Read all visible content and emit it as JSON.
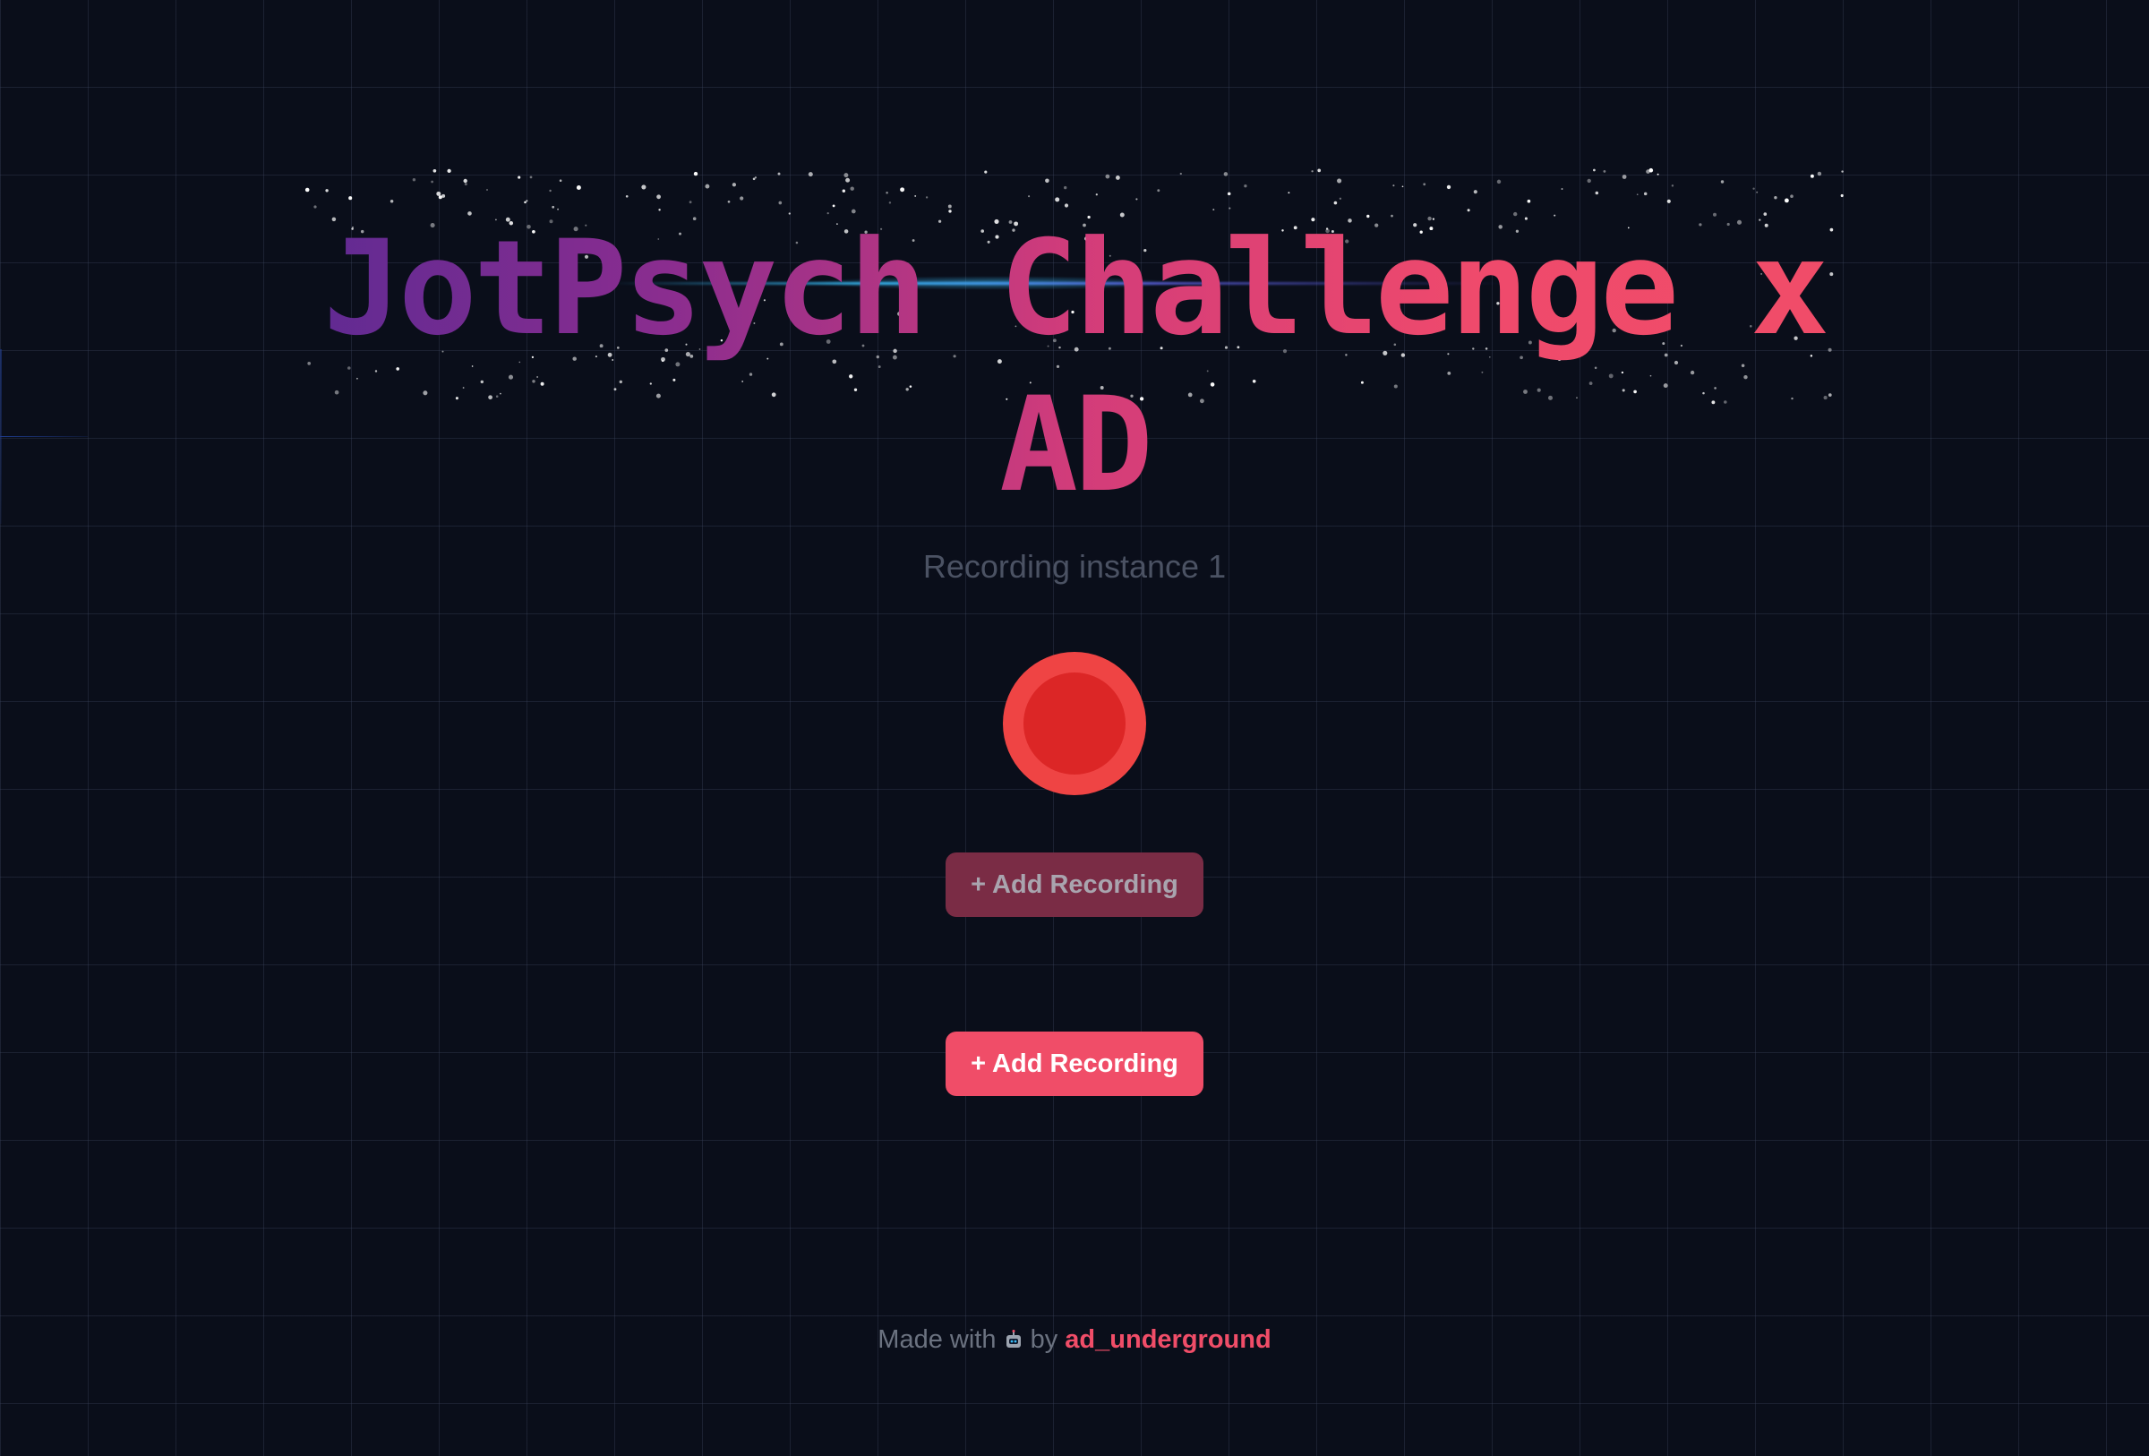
{
  "page": {
    "title": "JotPsych Challenge x AD",
    "background_color": "#0a0e1a",
    "accent_color": "#f04d68"
  },
  "recording": {
    "instance_label": "Recording instance 1",
    "record_button_color": "#ef4444",
    "record_button_icon": "record-icon"
  },
  "buttons": {
    "add_recording_disabled_label": "+ Add Recording",
    "add_recording_label": "+ Add Recording"
  },
  "footer": {
    "made_with": "Made with",
    "emoji_icon": "robot-icon",
    "by": "by",
    "author": "ad_underground"
  }
}
